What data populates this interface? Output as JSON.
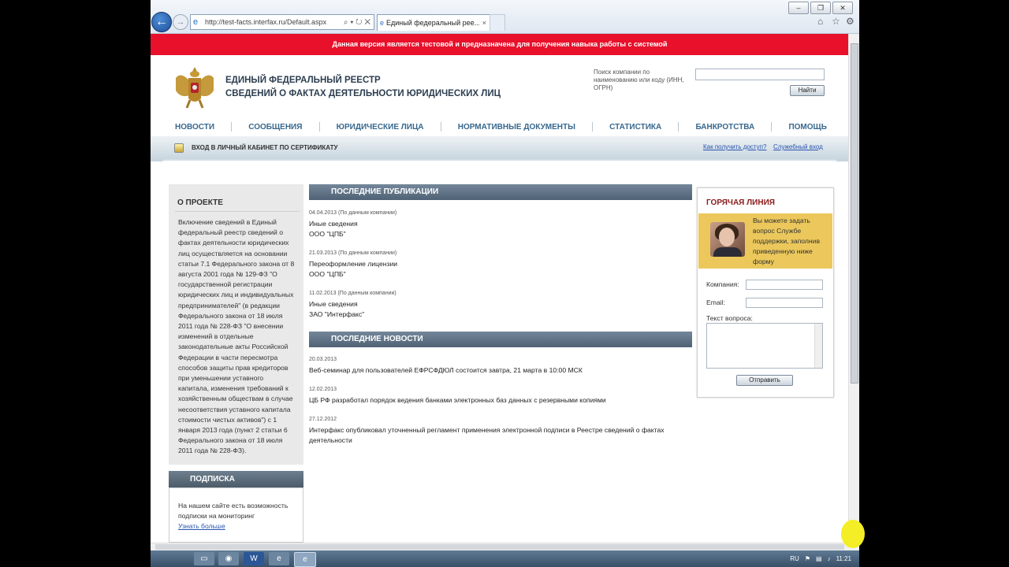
{
  "browser": {
    "url": "http://test-facts.interfax.ru/Default.aspx",
    "tab_title": "Единый федеральный рее...",
    "tab_close": "×",
    "back_glyph": "←",
    "forward_glyph": "→",
    "addr_actions": "⌕ ▾ ↻ ✕",
    "window_buttons": [
      "–",
      "❐",
      "✕"
    ],
    "tools": [
      "⌂",
      "☆",
      "⚙"
    ]
  },
  "banner": "Данная версия является тестовой и предназначена для получения навыка работы с системой",
  "header": {
    "title_line1": "ЕДИНЫЙ ФЕДЕРАЛЬНЫЙ РЕЕСТР",
    "title_line2": "СВЕДЕНИЙ О ФАКТАХ ДЕЯТЕЛЬНОСТИ ЮРИДИЧЕСКИХ ЛИЦ",
    "search_label": "Поиск компании по наименованию или коду (ИНН, ОГРН)",
    "search_value": "",
    "search_button": "Найти"
  },
  "nav": [
    "НОВОСТИ",
    "СООБЩЕНИЯ",
    "ЮРИДИЧЕСКИЕ ЛИЦА",
    "НОРМАТИВНЫЕ ДОКУМЕНТЫ",
    "СТАТИСТИКА",
    "БАНКРОТСТВА",
    "ПОМОЩЬ"
  ],
  "subbar": {
    "login": "ВХОД В ЛИЧНЫЙ КАБИНЕТ ПО СЕРТИФИКАТУ",
    "access_link": "Как получить доступ?",
    "service_link": "Служебный вход"
  },
  "about": {
    "title": "О ПРОЕКТЕ",
    "text": "Включение сведений в Единый федеральный реестр сведений о фактах деятельности юридических лиц осуществляется на основании статьи 7.1 Федерального закона от 8 августа 2001 года № 129-ФЗ \"О государственной регистрации юридических лиц и индивидуальных предпринимателей\" (в редакции Федерального закона от 18 июля 2011 года № 228-ФЗ \"О внесении изменений в отдельные законодательные акты Российской Федерации в части пересмотра способов защиты прав кредиторов при уменьшении уставного капитала, изменения требований к хозяйственным обществам в случае несоответствия уставного капитала стоимости чистых активов\") с 1 января 2013 года (пункт 2 статьи 6 Федерального закона от 18 июля 2011 года № 228-ФЗ)."
  },
  "subscription": {
    "title": "ПОДПИСКА",
    "text": "На нашем сайте есть возможность подписки на мониторинг",
    "link": "Узнать больше"
  },
  "publications": {
    "title": "ПОСЛЕДНИЕ ПУБЛИКАЦИИ",
    "items": [
      {
        "date": "04.04.2013",
        "note": "(По данным компании)",
        "type": "Иные сведения",
        "company": "ООО \"ЦПБ\""
      },
      {
        "date": "21.03.2013",
        "note": "(По данным компании)",
        "type": "Переоформление лицензии",
        "company": "ООО \"ЦПБ\""
      },
      {
        "date": "11.02.2013",
        "note": "(По данным компании)",
        "type": "Иные сведения",
        "company": "ЗАО \"Интерфакс\""
      }
    ]
  },
  "news": {
    "title": "ПОСЛЕДНИЕ НОВОСТИ",
    "items": [
      {
        "date": "20.03.2013",
        "text": "Веб-семинар для пользователей ЕФРСФДЮЛ состоится завтра, 21 марта в 10:00 МСК"
      },
      {
        "date": "12.02.2013",
        "text": "ЦБ РФ разработал порядок ведения банками электронных баз данных с резервными копиями"
      },
      {
        "date": "27.12.2012",
        "text": "Интерфакс опубликовал уточненный регламент применения электронной подписи в Реестре сведений о фактах деятельности"
      }
    ]
  },
  "hotline": {
    "title": "ГОРЯЧАЯ ЛИНИЯ",
    "text": "Вы можете задать вопрос Службе поддержки, заполнив приведенную ниже форму",
    "company_label": "Компания:",
    "company_value": "",
    "email_label": "Email:",
    "email_value": "",
    "question_label": "Текст вопроса:",
    "question_value": "",
    "send_button": "Отправить"
  },
  "taskbar": {
    "lang": "RU",
    "time": "11:21"
  },
  "colors": {
    "banner": "#e8102a",
    "nav_text": "#38688e",
    "hotline_panel": "#ecc85c",
    "section_header": "#5d7084"
  }
}
